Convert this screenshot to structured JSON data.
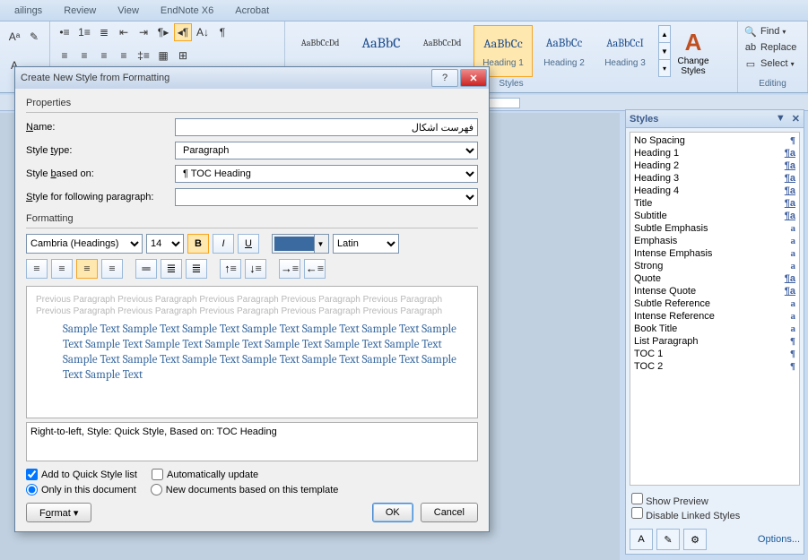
{
  "ribbon_tabs": {
    "mailings": "ailings",
    "review": "Review",
    "view": "View",
    "endnote": "EndNote X6",
    "acrobat": "Acrobat"
  },
  "ribbon": {
    "styles_label": "Styles",
    "change_styles": "Change Styles",
    "gallery": [
      {
        "sample": "AaBbCcDd",
        "name": ""
      },
      {
        "sample": "AaBbC",
        "name": ""
      },
      {
        "sample": "AaBbCcDd",
        "name": ""
      },
      {
        "sample": "AaBbCc",
        "name": "Heading 1"
      },
      {
        "sample": "AaBbCc",
        "name": "Heading 2"
      },
      {
        "sample": "AaBbCcI",
        "name": "Heading 3"
      }
    ],
    "editing_label": "Editing",
    "find": "Find",
    "replace": "Replace",
    "select": "Select"
  },
  "styles_pane": {
    "title": "Styles",
    "items": [
      {
        "name": "No Spacing",
        "sym": "¶"
      },
      {
        "name": "Heading 1",
        "sym": "¶a"
      },
      {
        "name": "Heading 2",
        "sym": "¶a"
      },
      {
        "name": "Heading 3",
        "sym": "¶a"
      },
      {
        "name": "Heading 4",
        "sym": "¶a"
      },
      {
        "name": "Title",
        "sym": "¶a"
      },
      {
        "name": "Subtitle",
        "sym": "¶a"
      },
      {
        "name": "Subtle Emphasis",
        "sym": "a"
      },
      {
        "name": "Emphasis",
        "sym": "a"
      },
      {
        "name": "Intense Emphasis",
        "sym": "a"
      },
      {
        "name": "Strong",
        "sym": "a"
      },
      {
        "name": "Quote",
        "sym": "¶a"
      },
      {
        "name": "Intense Quote",
        "sym": "¶a"
      },
      {
        "name": "Subtle Reference",
        "sym": "a"
      },
      {
        "name": "Intense Reference",
        "sym": "a"
      },
      {
        "name": "Book Title",
        "sym": "a"
      },
      {
        "name": "List Paragraph",
        "sym": "¶"
      },
      {
        "name": "TOC 1",
        "sym": "¶"
      },
      {
        "name": "TOC 2",
        "sym": "¶"
      }
    ],
    "show_preview": "Show Preview",
    "disable_linked": "Disable Linked Styles",
    "options": "Options..."
  },
  "dialog": {
    "title": "Create New Style from Formatting",
    "properties": "Properties",
    "name_label": "Name:",
    "name_value": "فهرست اشکال",
    "style_type_label": "Style type:",
    "style_type_value": "Paragraph",
    "based_on_label": "Style based on:",
    "based_on_value": "¶ TOC Heading",
    "following_label": "Style for following paragraph:",
    "following_value": "",
    "formatting": "Formatting",
    "font_name": "Cambria (Headings)",
    "font_size": "14",
    "script": "Latin",
    "preview_grey": "Previous Paragraph Previous Paragraph Previous Paragraph Previous Paragraph Previous Paragraph Previous Paragraph Previous Paragraph Previous Paragraph Previous Paragraph Previous Paragraph",
    "preview_sample": "Sample Text Sample Text Sample Text Sample Text Sample Text Sample Text Sample Text Sample Text Sample Text Sample Text Sample Text Sample Text Sample Text Sample Text Sample Text Sample Text Sample Text Sample Text Sample Text Sample Text Sample Text",
    "description": "Right-to-left, Style: Quick Style, Based on: TOC Heading",
    "add_quick": "Add to Quick Style list",
    "auto_update": "Automatically update",
    "only_doc": "Only in this document",
    "new_docs": "New documents based on this template",
    "format_btn": "Format",
    "ok": "OK",
    "cancel": "Cancel"
  }
}
